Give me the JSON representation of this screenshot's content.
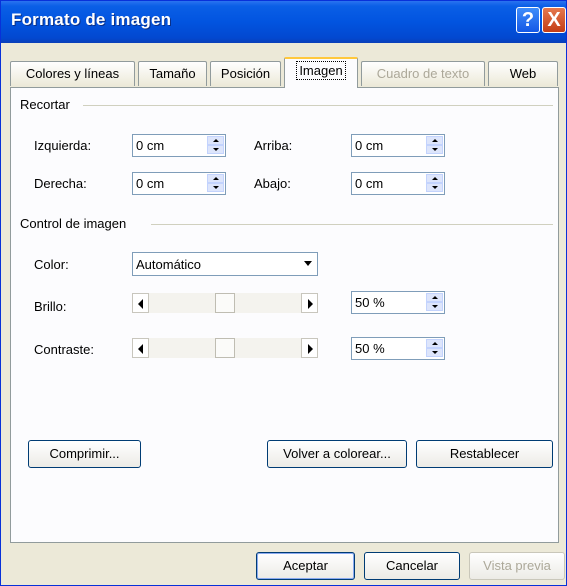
{
  "window": {
    "title": "Formato de imagen"
  },
  "titlebar": {
    "help": "?",
    "close": "X"
  },
  "tabs": [
    {
      "label": "Colores y líneas"
    },
    {
      "label": "Tamaño"
    },
    {
      "label": "Posición"
    },
    {
      "label": "Imagen"
    },
    {
      "label": "Cuadro de texto"
    },
    {
      "label": "Web"
    }
  ],
  "active_tab": "Imagen",
  "crop": {
    "group_title": "Recortar",
    "left_label": "Izquierda:",
    "left_value": "0 cm",
    "top_label": "Arriba:",
    "top_value": "0 cm",
    "right_label": "Derecha:",
    "right_value": "0 cm",
    "bottom_label": "Abajo:",
    "bottom_value": "0 cm"
  },
  "image_control": {
    "group_title": "Control de imagen",
    "color_label": "Color:",
    "color_value": "Automático",
    "brightness_label": "Brillo:",
    "brightness_value": "50 %",
    "brightness_level": 0.5,
    "contrast_label": "Contraste:",
    "contrast_value": "50 %",
    "contrast_level": 0.5
  },
  "buttons": {
    "compress": "Comprimir...",
    "recolor": "Volver a colorear...",
    "reset": "Restablecer",
    "ok": "Aceptar",
    "cancel": "Cancelar",
    "preview": "Vista previa"
  }
}
